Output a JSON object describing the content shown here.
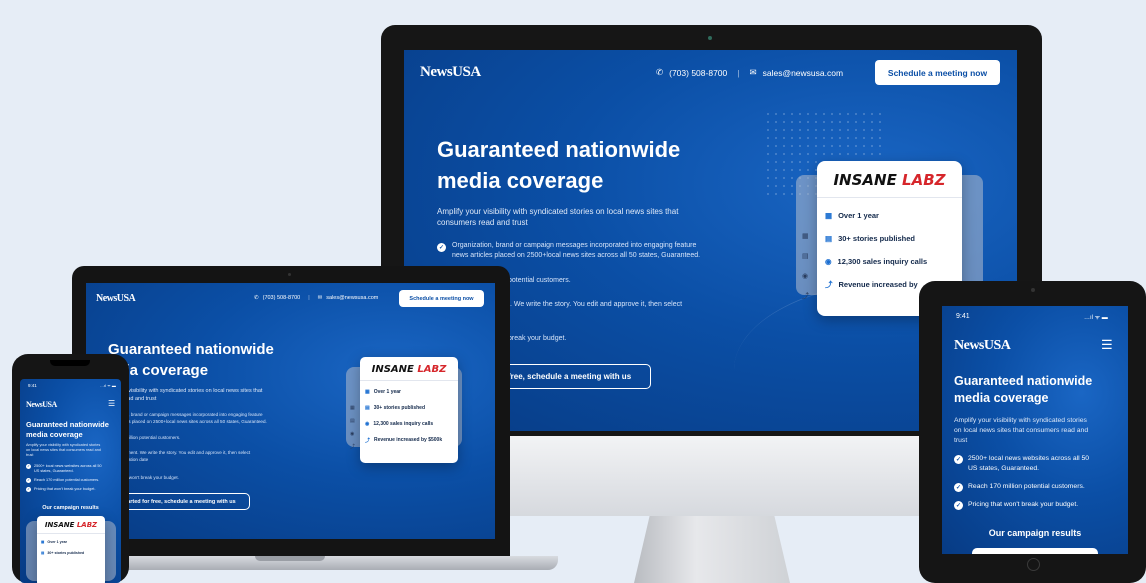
{
  "brand": {
    "logo": "NewsUSA"
  },
  "contact": {
    "phone": "(703) 508-8700",
    "email": "sales@newsusa.com",
    "cta": "Schedule a meeting now",
    "separator": "|"
  },
  "hero": {
    "title_line1": "Guaranteed nationwide",
    "title_line2": "media coverage",
    "subtitle_line1": "Amplify your visibility with syndicated stories on local news sites that",
    "subtitle_line2": "consumers read and trust",
    "bullets_desktop": [
      {
        "l1": "Organization, brand or campaign messages incorporated into engaging feature",
        "l2": "news articles placed on 2500+local news sites across all 50 states, Guaranteed."
      },
      {
        "l1": "potential customers.",
        "l2": ""
      },
      {
        "l1": "t. We write the story. You edit and approve it, then select",
        "l2": ""
      },
      {
        "l1": "break your budget.",
        "l2": ""
      }
    ],
    "cta_desktop": "free, schedule a meeting with us",
    "laptop_subtitle_line1": "your visibility with syndicated stories on local news sites that",
    "laptop_subtitle_line2": "re read and trust",
    "laptop_bullets": [
      "zation, brand or campaign messages incorporated into engaging feature",
      "articles placed on 2500+local news sites across all 50 states, Guaranteed.",
      "170 million potential customers.",
      "implement. We write the story. You edit and approve it, then select",
      "publication date",
      "g that won't break your budget."
    ],
    "laptop_title_line2": "edia coverage",
    "cta_laptop": "started for free, schedule a meeting with us"
  },
  "mobile": {
    "time": "9:41",
    "status": "…ıl ᯤ ▬",
    "subtitle_line1": "Amplify your visibility with syndicated stories",
    "subtitle_line2": "on local news sites that consumers read and",
    "subtitle_line3": "trust",
    "bullets": [
      {
        "l1": "2500+ local news websites across all 50",
        "l2": "US states, Guaranteed."
      },
      {
        "l1": "Reach 170 million potential customers.",
        "l2": ""
      },
      {
        "l1": "Pricing that won't break your budget.",
        "l2": ""
      }
    ],
    "results_heading": "Our campaign results",
    "menu_icon": "☰"
  },
  "campaign_card": {
    "brand_part1": "INSANE ",
    "brand_part2": "LABZ",
    "stats": [
      {
        "icon": "calendar-icon",
        "glyph": "▦",
        "label": "Over 1 year"
      },
      {
        "icon": "document-icon",
        "glyph": "▤",
        "label": "30+ stories published"
      },
      {
        "icon": "eye-icon",
        "glyph": "◉",
        "label": "12,300 sales inquiry calls"
      },
      {
        "icon": "chart-icon",
        "glyph": "⤴",
        "label": "Revenue increased by $500k"
      }
    ],
    "stat_desktop_revenue": "Revenue increased by"
  },
  "colors": {
    "brand_blue": "#0b4fa6",
    "accent_red": "#d6262b",
    "page_bg": "#e6edf6"
  }
}
